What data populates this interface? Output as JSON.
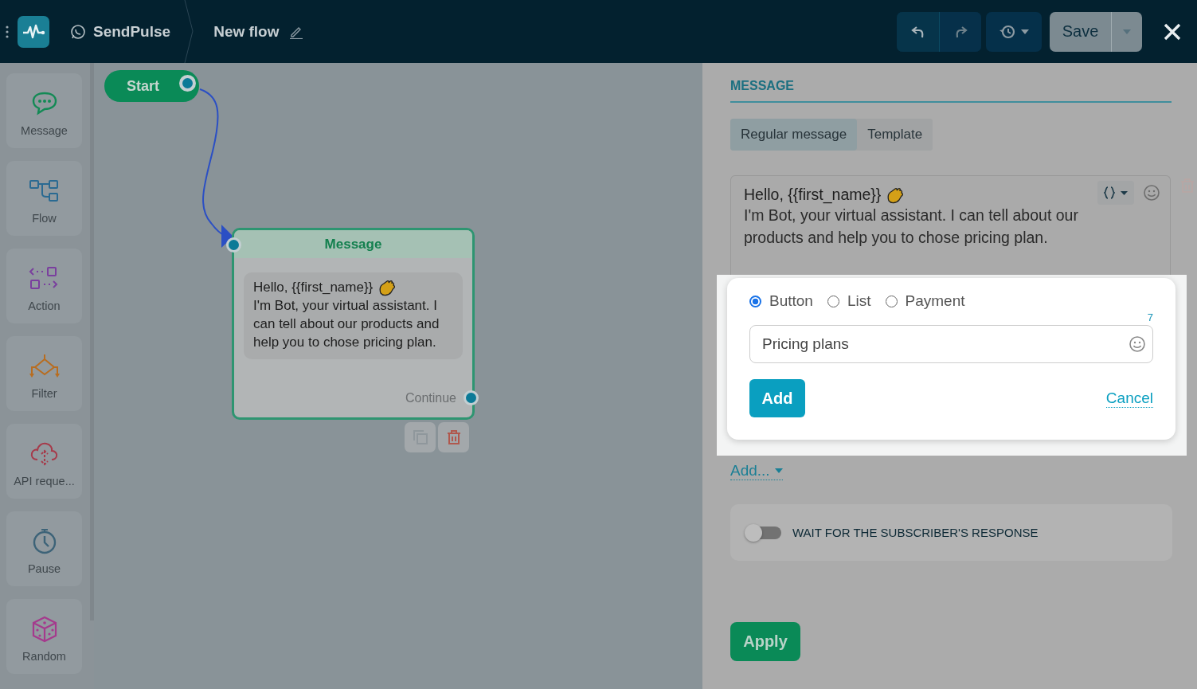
{
  "header": {
    "brand": "SendPulse",
    "flow_title": "New flow",
    "save_label": "Save"
  },
  "sidebar": {
    "items": [
      {
        "label": "Message",
        "kind": "message"
      },
      {
        "label": "Flow",
        "kind": "flow"
      },
      {
        "label": "Action",
        "kind": "action"
      },
      {
        "label": "Filter",
        "kind": "filter"
      },
      {
        "label": "API reque...",
        "kind": "api"
      },
      {
        "label": "Pause",
        "kind": "pause"
      },
      {
        "label": "Random",
        "kind": "random"
      }
    ]
  },
  "canvas": {
    "start_node": {
      "label": "Start"
    },
    "message_node": {
      "title": "Message",
      "greeting": "Hello, {{first_name}}",
      "text": "I'm Bot, your virtual assistant. I can tell about our products and help you to chose pricing plan.",
      "output": "Continue"
    }
  },
  "panel": {
    "heading": "MESSAGE",
    "tabs": [
      {
        "label": "Regular message",
        "selected": true
      },
      {
        "label": "Template",
        "selected": false
      }
    ],
    "message": {
      "greeting": "Hello, {{first_name}}",
      "text": "I'm Bot, your virtual assistant. I can tell about our products and help you to chose pricing plan."
    },
    "button_form": {
      "types": [
        {
          "label": "Button",
          "selected": true
        },
        {
          "label": "List",
          "selected": false
        },
        {
          "label": "Payment",
          "selected": false
        }
      ],
      "counter": "7",
      "value": "Pricing plans",
      "add": "Add",
      "cancel": "Cancel"
    },
    "add_menu": "Add...",
    "wait_toggle": {
      "label": "WAIT FOR THE SUBSCRIBER'S RESPONSE",
      "on": false
    },
    "apply": "Apply"
  }
}
